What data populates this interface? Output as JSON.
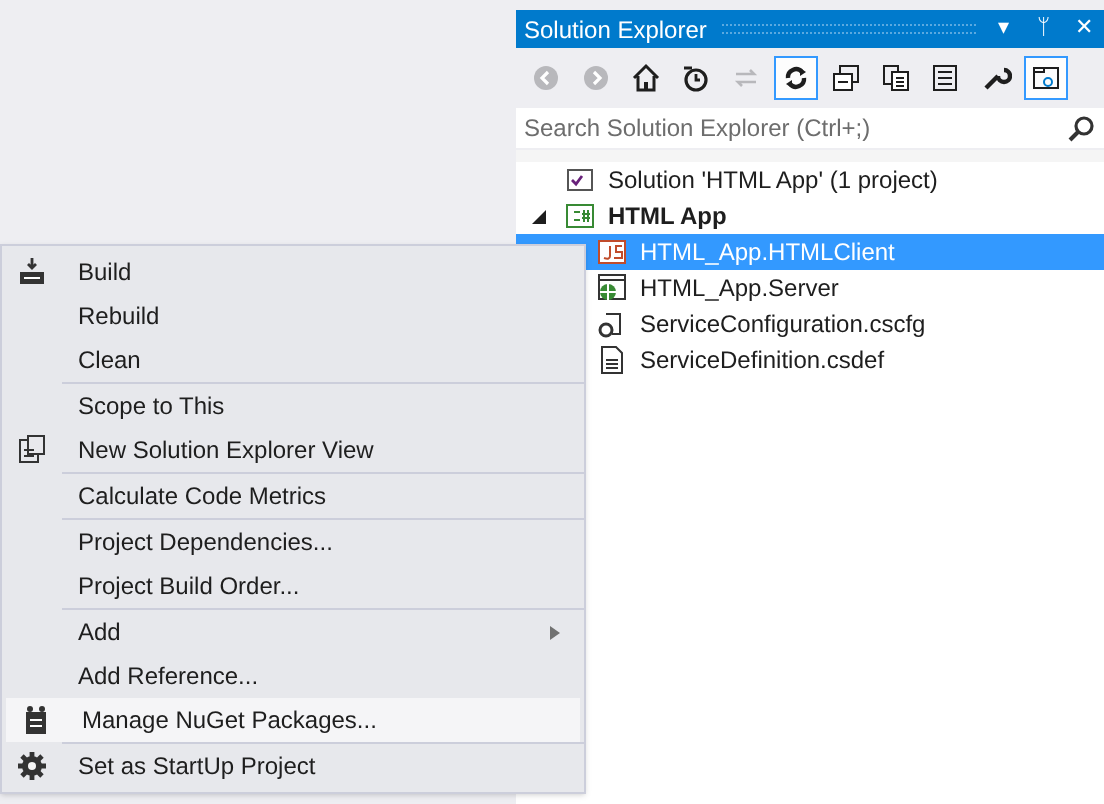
{
  "panel": {
    "title": "Solution Explorer",
    "title_buttons": [
      "▾",
      "ᛘ",
      "✕"
    ],
    "toolbar": [
      {
        "kind": "back",
        "pressed": false,
        "disabled": true
      },
      {
        "kind": "forward",
        "pressed": false,
        "disabled": true
      },
      {
        "kind": "home",
        "pressed": false,
        "disabled": false
      },
      {
        "kind": "history",
        "pressed": false,
        "disabled": false
      },
      {
        "kind": "refresh",
        "pressed": false,
        "disabled": true
      },
      {
        "kind": "sync",
        "pressed": true,
        "disabled": false
      },
      {
        "kind": "collapse",
        "pressed": false,
        "disabled": false
      },
      {
        "kind": "files",
        "pressed": false,
        "disabled": false
      },
      {
        "kind": "view",
        "pressed": false,
        "disabled": false
      },
      {
        "kind": "properties",
        "pressed": false,
        "disabled": false
      },
      {
        "kind": "preview",
        "pressed": true,
        "disabled": false
      }
    ],
    "search": {
      "placeholder": "Search Solution Explorer (Ctrl+;)"
    },
    "tree": [
      {
        "label": "Solution 'HTML App' (1 project)",
        "kind": "solution",
        "bold": false,
        "selected": false,
        "children": [
          {
            "label": "HTML App",
            "kind": "csharp",
            "bold": true,
            "selected": false,
            "expanded": true,
            "children": [
              {
                "label": "HTML_App.HTMLClient",
                "kind": "js",
                "bold": false,
                "selected": true
              },
              {
                "label": "HTML_App.Server",
                "kind": "web",
                "bold": false,
                "selected": false
              },
              {
                "label": "ServiceConfiguration.cscfg",
                "kind": "config",
                "bold": false,
                "selected": false
              },
              {
                "label": "ServiceDefinition.csdef",
                "kind": "file",
                "bold": false,
                "selected": false
              }
            ]
          }
        ]
      }
    ]
  },
  "context_menu": [
    [
      {
        "label": "Build",
        "kind": "build",
        "submenu": false,
        "selected": false
      },
      {
        "label": "Rebuild",
        "kind": "plain",
        "submenu": false,
        "selected": false
      },
      {
        "label": "Clean",
        "kind": "plain",
        "submenu": false,
        "selected": false
      }
    ],
    [
      {
        "label": "Scope to This",
        "kind": "plain",
        "submenu": false,
        "selected": false
      },
      {
        "label": "New Solution Explorer View",
        "kind": "view",
        "submenu": false,
        "selected": false
      }
    ],
    [
      {
        "label": "Calculate Code Metrics",
        "kind": "plain",
        "submenu": false,
        "selected": false
      }
    ],
    [
      {
        "label": "Project Dependencies...",
        "kind": "plain",
        "submenu": false,
        "selected": false
      },
      {
        "label": "Project Build Order...",
        "kind": "plain",
        "submenu": false,
        "selected": false
      }
    ],
    [
      {
        "label": "Add",
        "kind": "plain",
        "submenu": true,
        "selected": false
      },
      {
        "label": "Add Reference...",
        "kind": "plain",
        "submenu": false,
        "selected": false
      },
      {
        "label": "Manage NuGet Packages...",
        "kind": "nuget",
        "submenu": false,
        "selected": true
      }
    ],
    [
      {
        "label": "Set as StartUp Project",
        "kind": "settings",
        "submenu": false,
        "selected": false
      }
    ]
  ]
}
